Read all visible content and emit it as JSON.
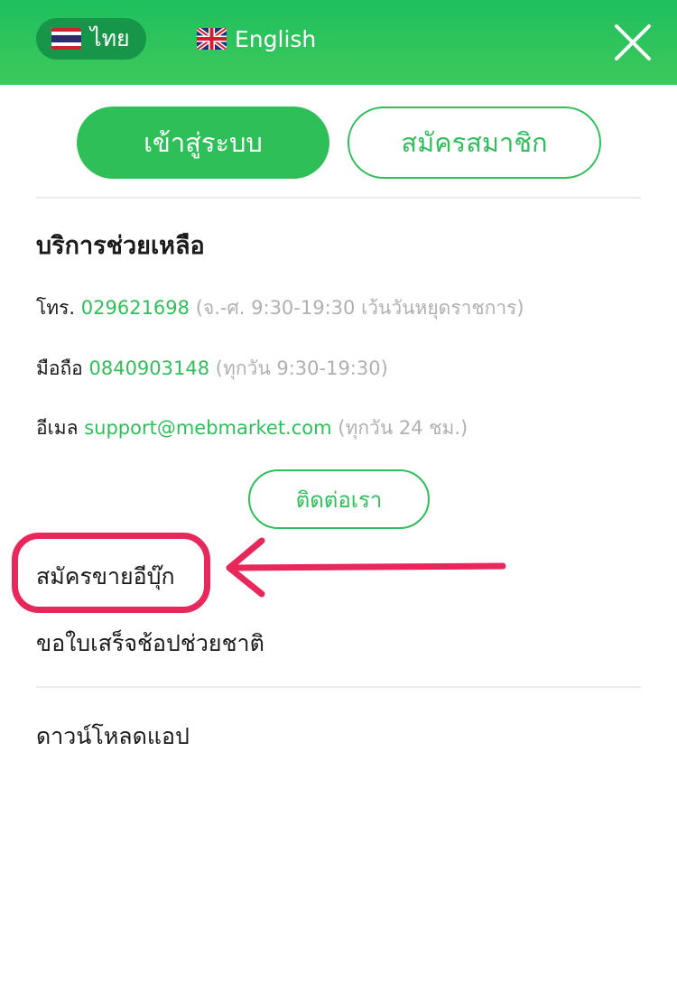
{
  "header": {
    "lang_thai": "ไทย",
    "lang_english": "English",
    "close_icon": "close-icon",
    "colors": {
      "bar": "#2fbf59",
      "active_pill": "#17964a"
    }
  },
  "auth": {
    "login_label": "เข้าสู่ระบบ",
    "register_label": "สมัครสมาชิก"
  },
  "help": {
    "title": "บริการช่วยเหลือ",
    "phone": {
      "label": "โทร.",
      "value": "029621698",
      "note": "(จ.-ศ. 9:30-19:30 เว้นวันหยุดราชการ)"
    },
    "mobile": {
      "label": "มือถือ",
      "value": "0840903148",
      "note": "(ทุกวัน 9:30-19:30)"
    },
    "email": {
      "label": "อีเมล",
      "value": "support@mebmarket.com",
      "note": "(ทุกวัน 24 ชม.)"
    },
    "contact_button": "ติดต่อเรา"
  },
  "menu": {
    "sell_ebook": "สมัครขายอีบุ๊ก",
    "tax_receipt": "ขอใบเสร็จช้อปช่วยชาติ",
    "download_app": "ดาวน์โหลดแอป"
  },
  "annotation": {
    "highlight_color": "#e8275a"
  }
}
